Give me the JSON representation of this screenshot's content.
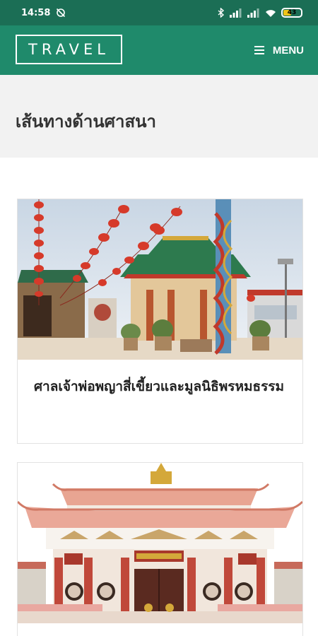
{
  "status": {
    "time": "14:58",
    "battery": "43"
  },
  "header": {
    "logo": "TRAVEL",
    "menu_label": "MENU"
  },
  "page": {
    "title": "เส้นทางด้านศาสนา"
  },
  "cards": [
    {
      "title": "ศาลเจ้าพ่อพญาสี่เขี้ยวและมูลนิธิพรหมธรรม"
    },
    {
      "title": ""
    }
  ],
  "colors": {
    "status_bar": "#1b6e55",
    "header": "#1f8a6b",
    "title_band": "#f2f2f2"
  }
}
